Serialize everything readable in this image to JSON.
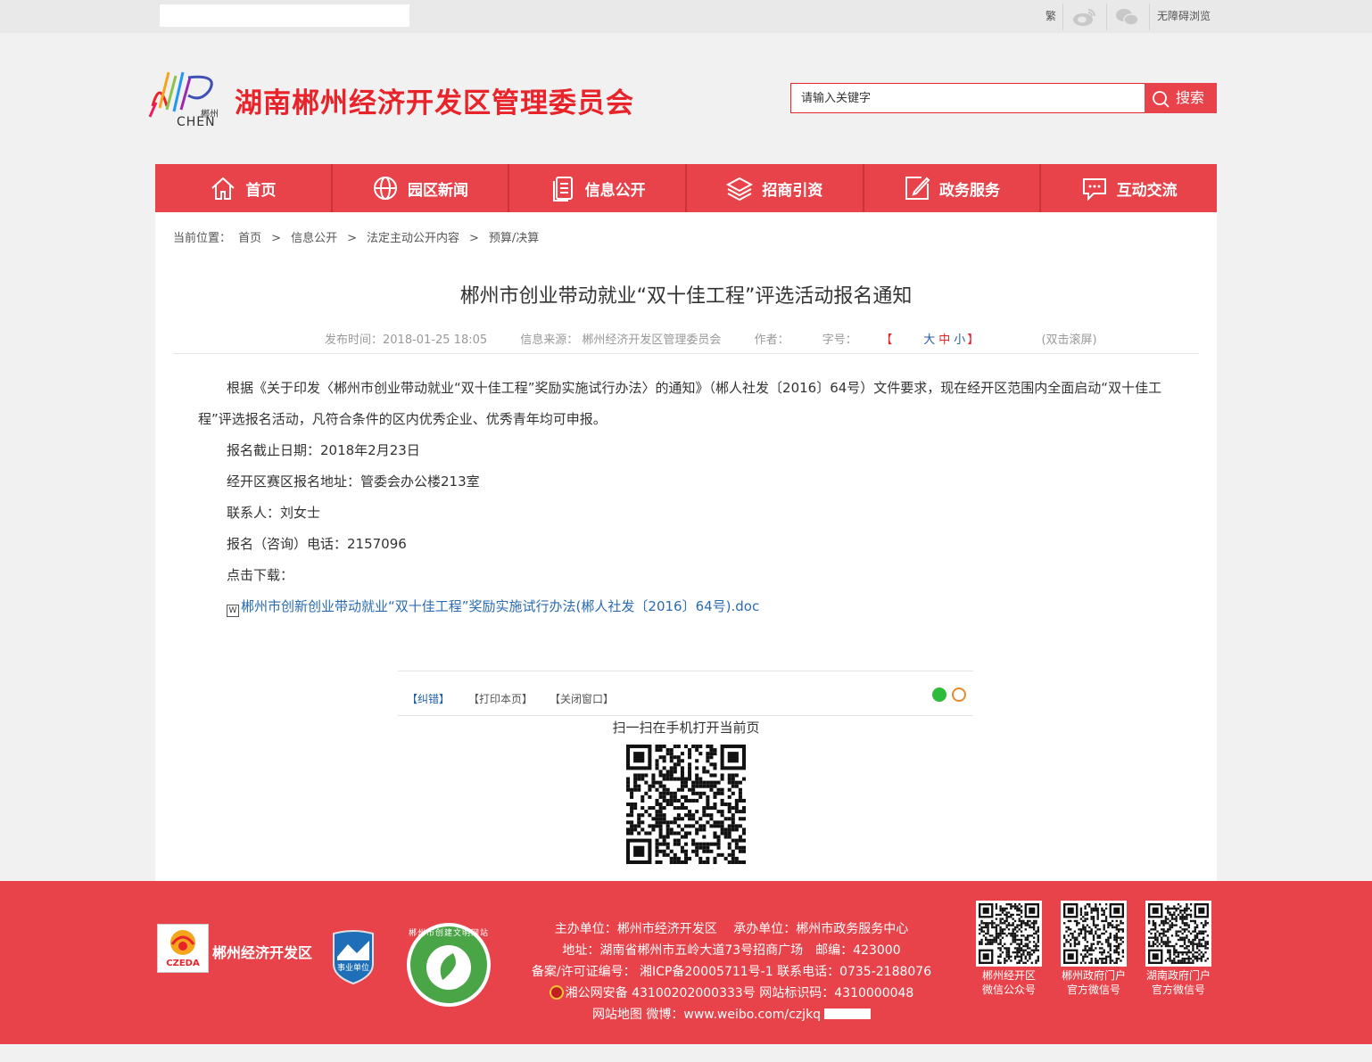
{
  "topbar": {
    "traditional_label": "繁",
    "weibo_icon": "weibo-icon",
    "wechat_icon": "wechat-icon",
    "accessibility_label": "无障碍浏览"
  },
  "header": {
    "logo_text_small": "郴州",
    "logo_text": "CHEN",
    "title": "湖南郴州经济开发区管理委员会",
    "search_placeholder": "请输入关键字",
    "search_button": "搜索",
    "accent_color": "#e8232a"
  },
  "nav": {
    "items": [
      {
        "label": "首页",
        "icon": "home-icon"
      },
      {
        "label": "园区新闻",
        "icon": "globe-icon"
      },
      {
        "label": "信息公开",
        "icon": "document-icon"
      },
      {
        "label": "招商引资",
        "icon": "layers-icon"
      },
      {
        "label": "政务服务",
        "icon": "edit-icon"
      },
      {
        "label": "互动交流",
        "icon": "chat-icon"
      }
    ]
  },
  "breadcrumb": {
    "prefix": "当前位置：",
    "items": [
      "首页",
      "信息公开",
      "法定主动公开内容",
      "预算/决算"
    ]
  },
  "article": {
    "title": "郴州市创业带动就业“双十佳工程”评选活动报名通知",
    "publish_time": "发布时间：2018-01-25 18:05",
    "source": "信息来源： 郴州经济开发区管理委员会",
    "author": "作者：",
    "font_size_label": "字号：",
    "font_size_open": "【",
    "font_size_large": "大",
    "font_size_medium": "中",
    "font_size_small": "小",
    "font_size_close": "】",
    "scroll_hint": "(双击滚屏)",
    "paragraphs": [
      "根据《关于印发〈郴州市创业带动就业“双十佳工程”奖励实施试行办法〉的通知》（郴人社发〔2016〕64号）文件要求，现在经开区范围内全面启动“双十佳工程”评选报名活动，凡符合条件的区内优秀企业、优秀青年均可申报。",
      "报名截止日期：2018年2月23日",
      "经开区赛区报名地址：管委会办公楼213室",
      "联系人：刘女士",
      "报名（咨询）电话：2157096",
      "点击下载："
    ],
    "attachment": "郴州市创新创业带动就业“双十佳工程”奖励实施试行办法(郴人社发〔2016〕64号).doc"
  },
  "tools": {
    "correct": "【纠错】",
    "print": "【打印本页】",
    "close": "【关闭窗口】",
    "scan_text": "扫一扫在手机打开当前页"
  },
  "footer": {
    "org_name": "郴州经济开发区",
    "logo1_text": "CZEDA",
    "badge_text": "事业单位",
    "seal_text": "郴州市创建文明网站",
    "lines": [
      "主办单位：郴州市经济开发区　 承办单位：郴州市政务服务中心",
      "地址：湖南省郴州市五岭大道73号招商广场　邮编：423000",
      "备案/许可证编号： 湘ICP备20005711号-1 联系电话：0735-2188076"
    ],
    "police_line": "湘公网安备 43100202000333号 网站标识码：4310000048",
    "sitemap_line": "网站地图 微博：www.weibo.com/czjkq",
    "qrcodes": [
      {
        "line1": "郴州经开区",
        "line2": "微信公众号"
      },
      {
        "line1": "郴州政府门户",
        "line2": "官方微信号"
      },
      {
        "line1": "湖南政府门户",
        "line2": "官方微信号"
      }
    ]
  }
}
